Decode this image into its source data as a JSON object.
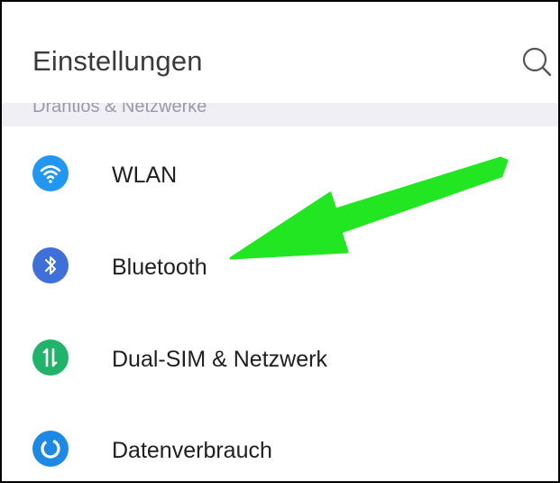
{
  "header": {
    "title": "Einstellungen",
    "search_icon": "search-icon"
  },
  "section": {
    "label": "Drahtlos & Netzwerke"
  },
  "items": [
    {
      "label": "WLAN",
      "icon": "wifi-icon",
      "color": "#2196F3"
    },
    {
      "label": "Bluetooth",
      "icon": "bluetooth-icon",
      "color": "#3F6FD8"
    },
    {
      "label": "Dual-SIM & Netzwerk",
      "icon": "data-transfer-icon",
      "color": "#22B36B"
    },
    {
      "label": "Datenverbrauch",
      "icon": "data-usage-icon",
      "color": "#1E88E5"
    }
  ],
  "annotation": {
    "arrow_color": "#22E622",
    "points_to": "Bluetooth"
  }
}
